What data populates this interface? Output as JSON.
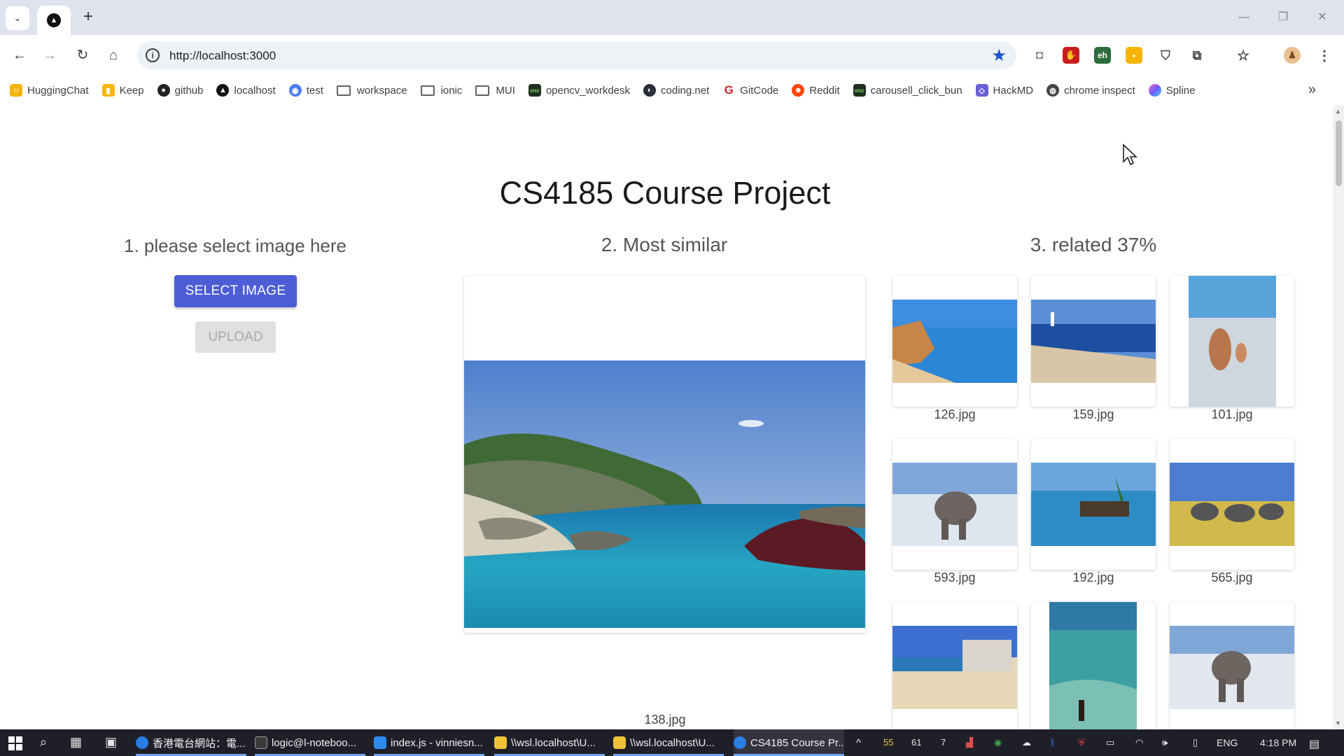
{
  "browser": {
    "new_tab_label": "+",
    "window_controls": {
      "minimize": "—",
      "restore": "❐",
      "close": "✕"
    },
    "url": "http://localhost:3000",
    "bookmarks": [
      {
        "label": "HuggingChat",
        "icon": "huggingface-icon",
        "color": "#f5b400"
      },
      {
        "label": "Keep",
        "icon": "keep-icon",
        "color": "#f6b70b"
      },
      {
        "label": "github",
        "icon": "github-icon",
        "color": "#222222"
      },
      {
        "label": "localhost",
        "icon": "next-icon",
        "color": "#111111"
      },
      {
        "label": "test",
        "icon": "radio-icon",
        "color": "#4f7cf7"
      },
      {
        "label": "workspace",
        "icon": "folder-icon",
        "color": ""
      },
      {
        "label": "ionic",
        "icon": "folder-icon",
        "color": ""
      },
      {
        "label": "MUI",
        "icon": "folder-icon",
        "color": ""
      },
      {
        "label": "opencv_workdesk",
        "icon": "vnc-icon",
        "color": "#1f2f1f"
      },
      {
        "label": "coding.net",
        "icon": "coding-icon",
        "color": "#2a2d3a"
      },
      {
        "label": "GitCode",
        "icon": "gitcode-icon",
        "color": "#d8252d"
      },
      {
        "label": "Reddit",
        "icon": "reddit-icon",
        "color": "#ff4500"
      },
      {
        "label": "carousell_click_bun",
        "icon": "vnc-icon",
        "color": "#1f2f1f"
      },
      {
        "label": "HackMD",
        "icon": "hackmd-icon",
        "color": "#6b5fd6"
      },
      {
        "label": "chrome inspect",
        "icon": "globe-icon",
        "color": "#444444"
      },
      {
        "label": "Spline",
        "icon": "spline-icon",
        "color": "#8a5cf6"
      }
    ],
    "bookmarks_more": "»"
  },
  "page": {
    "title": "CS4185 Course Project",
    "section1_heading": "1. please select image here",
    "select_button": "SELECT IMAGE",
    "upload_button": "UPLOAD",
    "section2_heading": "2. Most similar",
    "most_similar_caption": "138.jpg",
    "section3_heading": "3. related 37%",
    "related": [
      {
        "file": "126.jpg",
        "subject": "beach-cliff"
      },
      {
        "file": "159.jpg",
        "subject": "beach-lighthouse"
      },
      {
        "file": "101.jpg",
        "subject": "beach-people"
      },
      {
        "file": "593.jpg",
        "subject": "elephant"
      },
      {
        "file": "192.jpg",
        "subject": "beach-hut"
      },
      {
        "file": "565.jpg",
        "subject": "elephant-herd"
      },
      {
        "file": "",
        "subject": "beach-hotels"
      },
      {
        "file": "",
        "subject": "sea-person"
      },
      {
        "file": "",
        "subject": "elephant"
      }
    ]
  },
  "taskbar": {
    "apps": [
      {
        "label": "香港電台網站：電...",
        "color": "#2a7de1"
      },
      {
        "label": "logic@l-noteboo...",
        "color": "#3b3b3b"
      },
      {
        "label": "index.js - vinniesn...",
        "color": "#2d8cf0"
      },
      {
        "label": "\\\\wsl.localhost\\U...",
        "color": "#f0c23a"
      },
      {
        "label": "\\\\wsl.localhost\\U...",
        "color": "#f0c23a"
      },
      {
        "label": "CS4185 Course Pr...",
        "color": "#2a7de1"
      }
    ],
    "tray_numbers": [
      "55",
      "61",
      "7"
    ],
    "language": "ENG",
    "time": "4:18 PM"
  }
}
